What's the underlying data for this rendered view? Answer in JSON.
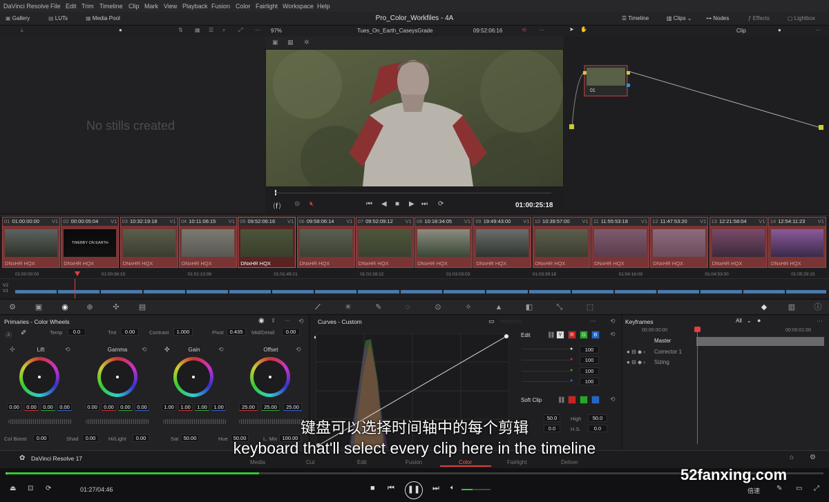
{
  "menu": [
    "DaVinci Resolve",
    "File",
    "Edit",
    "Trim",
    "Timeline",
    "Clip",
    "Mark",
    "View",
    "Playback",
    "Fusion",
    "Color",
    "Fairlight",
    "Workspace",
    "Help"
  ],
  "toolbar": {
    "gallery": "Gallery",
    "luts": "LUTs",
    "media_pool": "Media Pool",
    "project": "Pro_Color_Workfiles - 4A",
    "timeline_btn": "Timeline",
    "clips_btn": "Clips",
    "nodes_btn": "Nodes",
    "effects_btn": "Effects",
    "lightbox_btn": "Lightbox"
  },
  "viewer": {
    "zoom": "97%",
    "timeline_name": "Tues_On_Earth_CaseysGrade",
    "timecode": "09:52:06:16",
    "clip_mode": "Clip",
    "playhead_tc": "01:00:25:18"
  },
  "gallery": {
    "empty": "No stills created"
  },
  "node": {
    "label": "01"
  },
  "clips": [
    {
      "num": "01",
      "tc": "01:00:00:00",
      "track": "V1",
      "codec": "DNxHR HQX",
      "c1": "#5d6360",
      "c2": "#2c3028"
    },
    {
      "num": "02",
      "tc": "00:00:05:04",
      "track": "V1",
      "codec": "DNxHR HQX",
      "c1": "#0a0a0a",
      "c2": "#111111",
      "title": "TWEBBY ON EARTH"
    },
    {
      "num": "03",
      "tc": "10:32:19:18",
      "track": "V1",
      "codec": "DNxHR HQX",
      "c1": "#5a5e4a",
      "c2": "#3a3c30"
    },
    {
      "num": "04",
      "tc": "10:11:06:15",
      "track": "V1",
      "codec": "DNxHR HQX",
      "c1": "#7a7a72",
      "c2": "#585852"
    },
    {
      "num": "05",
      "tc": "09:52:06:16",
      "track": "V1",
      "codec": "DNxHR HQX",
      "c1": "#4c5438",
      "c2": "#3a3e2c"
    },
    {
      "num": "06",
      "tc": "09:58:06:14",
      "track": "V1",
      "codec": "DNxHR HQX",
      "c1": "#5a6050",
      "c2": "#3c4034"
    },
    {
      "num": "07",
      "tc": "09:52:09:12",
      "track": "V1",
      "codec": "DNxHR HQX",
      "c1": "#4e563a",
      "c2": "#3a4030"
    },
    {
      "num": "08",
      "tc": "10:18:34:05",
      "track": "V1",
      "codec": "DNxHR HQX",
      "c1": "#8a8c80",
      "c2": "#3a4836"
    },
    {
      "num": "09",
      "tc": "19:49:43:00",
      "track": "V1",
      "codec": "DNxHR HQX",
      "c1": "#6a6e6c",
      "c2": "#2e3430"
    },
    {
      "num": "10",
      "tc": "10:39:57:00",
      "track": "V1",
      "codec": "DNxHR HQX",
      "c1": "#5c5e4c",
      "c2": "#3a3c30"
    },
    {
      "num": "11",
      "tc": "11:55:53:18",
      "track": "V1",
      "codec": "DNxHR HQX",
      "c1": "#7c5c6c",
      "c2": "#5c3c4c"
    },
    {
      "num": "12",
      "tc": "11:47:53:20",
      "track": "V1",
      "codec": "DNxHR HQX",
      "c1": "#8c6c7c",
      "c2": "#6c4c5c"
    },
    {
      "num": "13",
      "tc": "12:21:58:04",
      "track": "V1",
      "codec": "DNxHR HQX",
      "c1": "#7a4a6a",
      "c2": "#3c2a3a"
    },
    {
      "num": "14",
      "tc": "12:54:11:23",
      "track": "V1",
      "codec": "DNxHR HQX",
      "c1": "#8a5a9a",
      "c2": "#3a2a4a"
    }
  ],
  "ruler": [
    "01:00:00:00",
    "01:00:36:15",
    "01:01:13:06",
    "01:01:49:21",
    "01:02:26:12",
    "01:03:03:03",
    "01:03:39:18",
    "01:04:16:09",
    "01:04:53:00",
    "01:05:29:15"
  ],
  "tracks": {
    "v2": "V2",
    "v1": "V1"
  },
  "primaries": {
    "title": "Primaries - Color Wheels",
    "temp_l": "Temp",
    "temp": "0.0",
    "tint_l": "Tint",
    "tint": "0.00",
    "contrast_l": "Contrast",
    "contrast": "1.000",
    "pivot_l": "Pivot",
    "pivot": "0.435",
    "middetail_l": "Mid/Detail",
    "middetail": "0.00",
    "wheels": [
      {
        "name": "Lift",
        "vals": [
          "0.00",
          "0.00",
          "0.00",
          "0.00"
        ]
      },
      {
        "name": "Gamma",
        "vals": [
          "0.00",
          "0.00",
          "0.00",
          "0.00"
        ]
      },
      {
        "name": "Gain",
        "vals": [
          "1.00",
          "1.00",
          "1.00",
          "1.00"
        ]
      },
      {
        "name": "Offset",
        "vals": [
          "25.00",
          "25.00",
          "25.00"
        ]
      }
    ],
    "colboost_l": "Col Boost",
    "colboost": "0.00",
    "shad_l": "Shad",
    "shad": "0.00",
    "hilight_l": "Hi/Light",
    "hilight": "0.00",
    "sat_l": "Sat",
    "sat": "50.00",
    "hue_l": "Hue",
    "hue": "50.00",
    "lmix_l": "L. Mix",
    "lmix": "100.00"
  },
  "curves": {
    "title": "Curves - Custom",
    "edit": "Edit",
    "y": "Y",
    "r": "R",
    "g": "G",
    "b": "B",
    "intens": [
      "100",
      "100",
      "100",
      "100"
    ],
    "softclip": "Soft Clip",
    "low": "50.0",
    "lowsoft": "0.0",
    "high_l": "High",
    "high": "50.0",
    "hs_l": "H.S.",
    "hs": "0.0"
  },
  "keyframes": {
    "title": "Keyframes",
    "filter": "All",
    "tc0": "00:00:00:00",
    "tc1": "00:00:01:00",
    "rows": [
      "Master",
      "Corrector 1",
      "Sizing"
    ]
  },
  "footer": {
    "app": "DaVinci Resolve 17",
    "pages": [
      "Media",
      "Cut",
      "Edit",
      "Fusion",
      "Color",
      "Fairlight",
      "Deliver"
    ],
    "active": "Color"
  },
  "player": {
    "time": "01:27/04:46",
    "speed": "倍速",
    "progress": 0.31
  },
  "subtitle": {
    "cn": "键盘可以选择时间轴中的每个剪辑",
    "en": "keyboard that'll select every clip here in the timeline"
  },
  "watermark": "52fanxing.com"
}
